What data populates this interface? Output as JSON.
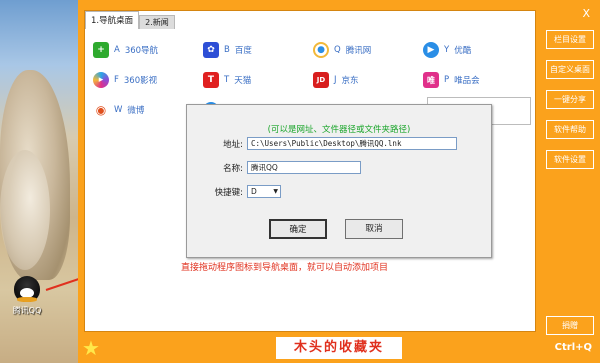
{
  "app": {
    "close_label": "X",
    "tabs": [
      {
        "label": "1.导航桌面"
      },
      {
        "label": "2.新闻"
      }
    ],
    "shortcuts": [
      {
        "key": "A",
        "name": "360导航",
        "icon": "360-nav-icon",
        "color": "#2eaa2e",
        "glyph": "＋"
      },
      {
        "key": "B",
        "name": "百度",
        "icon": "baidu-icon",
        "color": "#2d4fd6",
        "glyph": "🐾"
      },
      {
        "key": "Q",
        "name": "腾讯网",
        "icon": "qq-web-icon",
        "color": "#f2b93a",
        "glyph": "◉"
      },
      {
        "key": "Y",
        "name": "优酷",
        "icon": "youku-icon",
        "color": "#2a8ee6",
        "glyph": "▶"
      },
      {
        "key": "F",
        "name": "360影视",
        "icon": "360-video-icon",
        "color": "#8e4bd6",
        "glyph": "●"
      },
      {
        "key": "T",
        "name": "天猫",
        "icon": "tmall-icon",
        "color": "#e02020",
        "glyph": "T"
      },
      {
        "key": "J",
        "name": "京东",
        "icon": "jd-icon",
        "color": "#d81e1e",
        "glyph": "JD"
      },
      {
        "key": "P",
        "name": "唯品会",
        "icon": "vip-icon",
        "color": "#e0308a",
        "glyph": "唯"
      },
      {
        "key": "W",
        "name": "微博",
        "icon": "weibo-icon",
        "color": "#e0501e",
        "glyph": "◎"
      }
    ],
    "side_buttons": [
      {
        "label": "栏目设置"
      },
      {
        "label": "自定义桌面"
      },
      {
        "label": "一键分享"
      },
      {
        "label": "软件帮助"
      },
      {
        "label": "软件设置"
      }
    ],
    "donate_label": "捐赠",
    "brand_text": "木头的收藏夹",
    "hotkey_text": "Ctrl+Q"
  },
  "dialog": {
    "hint": "(可以是网址、文件器径或文件夹路径)",
    "address_label": "地址:",
    "address_value": "C:\\Users\\Public\\Desktop\\腾讯QQ.lnk",
    "name_label": "名称:",
    "name_value": "腾讯QQ",
    "hotkey_label": "快捷键:",
    "hotkey_value": "D",
    "ok_label": "确定",
    "cancel_label": "取消"
  },
  "annotation": {
    "text": "直接拖动程序图标到导航桌面，就可以自动添加项目"
  },
  "desktop": {
    "qq_icon_label": "腾讯QQ"
  }
}
